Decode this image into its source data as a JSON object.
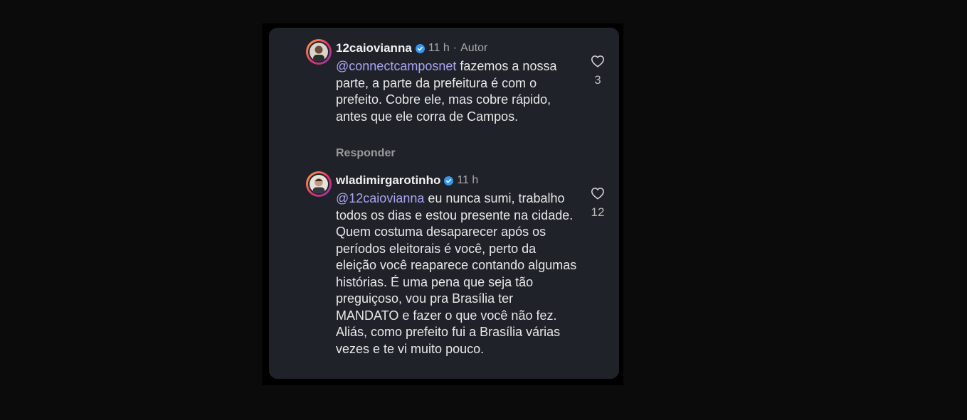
{
  "comments": [
    {
      "username": "12caiovianna",
      "time": "11 h",
      "separator": "·",
      "author_tag": "Autor",
      "mention": "@connectcamposnet",
      "text": "fazemos a nossa parte, a parte da prefeitura é com o prefeito. Cobre ele, mas cobre rápido, antes que ele corra de Campos.",
      "reply_label": "Responder",
      "likes": "3"
    },
    {
      "username": "wladimirgarotinho",
      "time": "11 h",
      "mention": "@12caiovianna",
      "text": "eu nunca sumi, trabalho todos os dias e estou presente na cidade. Quem costuma desaparecer após os períodos eleitorais é você, perto da eleição você reaparece contando algumas histórias. É uma pena que seja tão preguiçoso, vou pra Brasília ter MANDATO e fazer o que você não fez. Aliás, como prefeito fui a Brasília várias vezes e te vi muito pouco.",
      "likes": "12"
    }
  ],
  "colors": {
    "card_background": "#1f2229",
    "mention": "#a9a5f3",
    "verified_badge": "#3797f0"
  },
  "icons": {
    "verified": "verified-badge-icon",
    "like": "heart-outline-icon"
  }
}
